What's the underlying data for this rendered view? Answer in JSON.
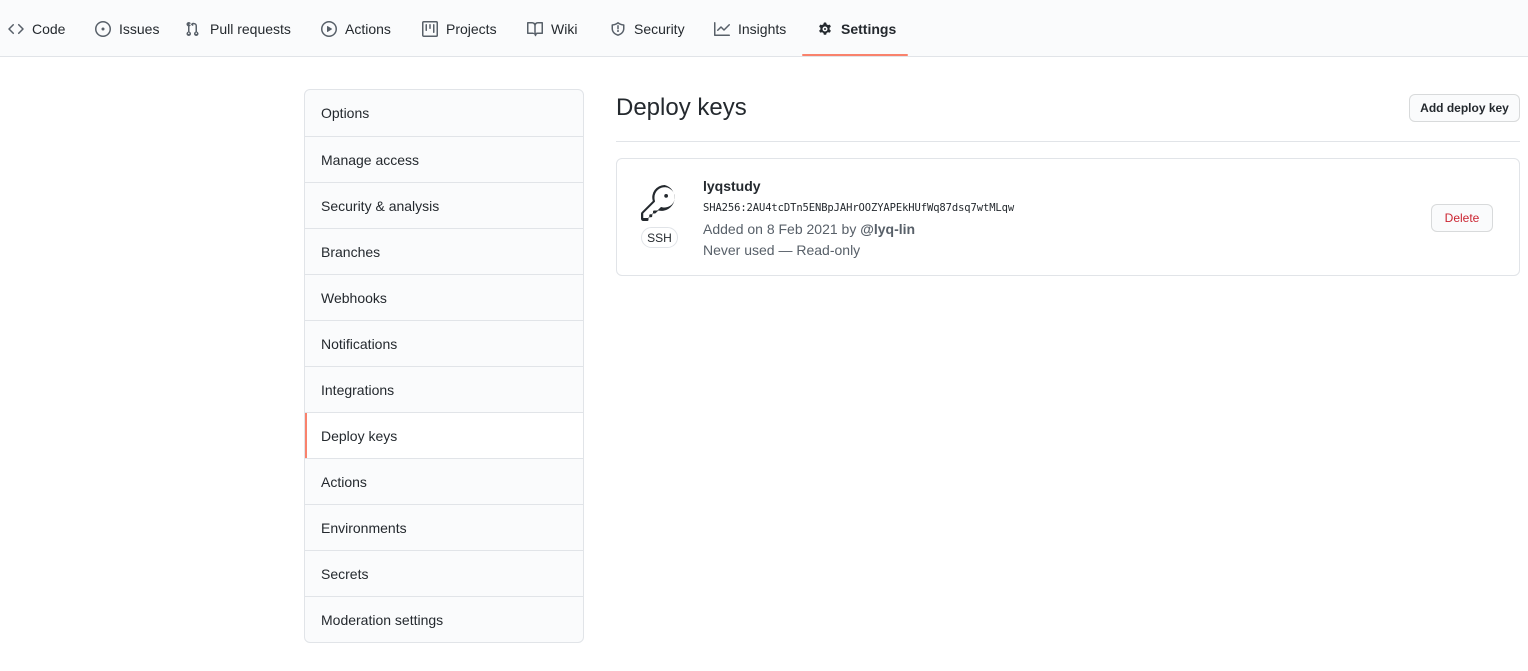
{
  "repo_nav": {
    "tabs": [
      {
        "label": "Code",
        "icon": "code-icon"
      },
      {
        "label": "Issues",
        "icon": "issue-opened-icon"
      },
      {
        "label": "Pull requests",
        "icon": "git-pull-request-icon"
      },
      {
        "label": "Actions",
        "icon": "play-icon"
      },
      {
        "label": "Projects",
        "icon": "project-icon"
      },
      {
        "label": "Wiki",
        "icon": "book-icon"
      },
      {
        "label": "Security",
        "icon": "shield-icon"
      },
      {
        "label": "Insights",
        "icon": "graph-icon"
      },
      {
        "label": "Settings",
        "icon": "gear-icon",
        "selected": true
      }
    ],
    "accent_color": "#f9826c"
  },
  "settings_menu": {
    "items": [
      {
        "label": "Options"
      },
      {
        "label": "Manage access"
      },
      {
        "label": "Security & analysis"
      },
      {
        "label": "Branches"
      },
      {
        "label": "Webhooks"
      },
      {
        "label": "Notifications"
      },
      {
        "label": "Integrations"
      },
      {
        "label": "Deploy keys",
        "selected": true
      },
      {
        "label": "Actions"
      },
      {
        "label": "Environments"
      },
      {
        "label": "Secrets"
      },
      {
        "label": "Moderation settings"
      }
    ]
  },
  "main": {
    "title": "Deploy keys",
    "add_button_label": "Add deploy key",
    "keys": [
      {
        "icon": "key-icon",
        "type_badge": "SSH",
        "title": "lyqstudy",
        "fingerprint": "SHA256:2AU4tcDTn5ENBpJAHrOOZYAPEkHUfWq87dsq7wtMLqw",
        "added_prefix": "Added on 8 Feb 2021 by",
        "added_by": "@lyq-lin",
        "usage": "Never used — Read-only",
        "delete_label": "Delete"
      }
    ],
    "danger_color": "#cb2431"
  }
}
